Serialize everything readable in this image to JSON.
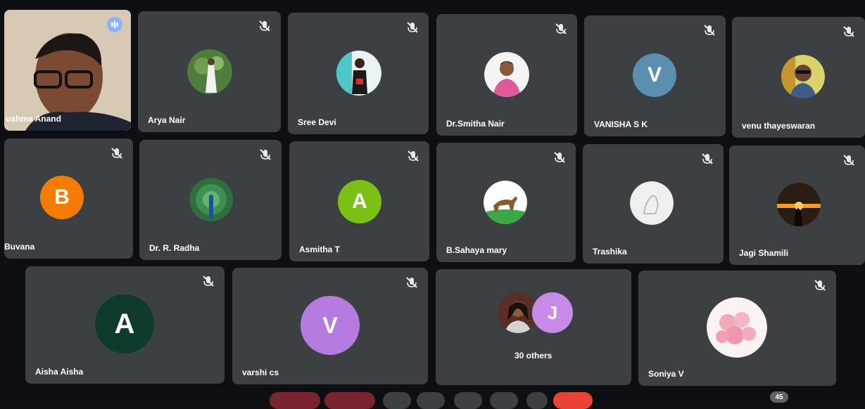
{
  "participants": {
    "p1": {
      "name": "ushma Anand"
    },
    "p2": {
      "name": "Arya Nair"
    },
    "p3": {
      "name": "Sree Devi"
    },
    "p4": {
      "name": "Dr.Smitha Nair"
    },
    "p5": {
      "name": "VANISHA S K",
      "initial": "V"
    },
    "p6": {
      "name": "venu thayeswaran"
    },
    "p7": {
      "name": "Buvana",
      "initial": "B"
    },
    "p8": {
      "name": "Dr. R. Radha"
    },
    "p9": {
      "name": "Asmitha T",
      "initial": "A"
    },
    "p10": {
      "name": "B.Sahaya mary"
    },
    "p11": {
      "name": "Trashika"
    },
    "p12": {
      "name": "Jagi Shamili"
    },
    "p13": {
      "name": "Aisha Aisha",
      "initial": "A"
    },
    "p14": {
      "name": "varshi cs",
      "initial": "V"
    },
    "p15": {
      "name": "Soniya V"
    }
  },
  "others": {
    "label": "30 others",
    "initial": "J"
  },
  "participant_count": "45",
  "colors": {
    "tile_bg": "#3c4043",
    "speaking_outline": "#8ab4f8",
    "avatar_vanisha": "#5a8fb0",
    "avatar_buvana": "#f57c00",
    "avatar_asmitha": "#7cc016",
    "avatar_aisha": "#0f3b2e",
    "avatar_varshi": "#b57be0",
    "avatar_others": "#c88ae8",
    "leave_button": "#ea4335"
  }
}
